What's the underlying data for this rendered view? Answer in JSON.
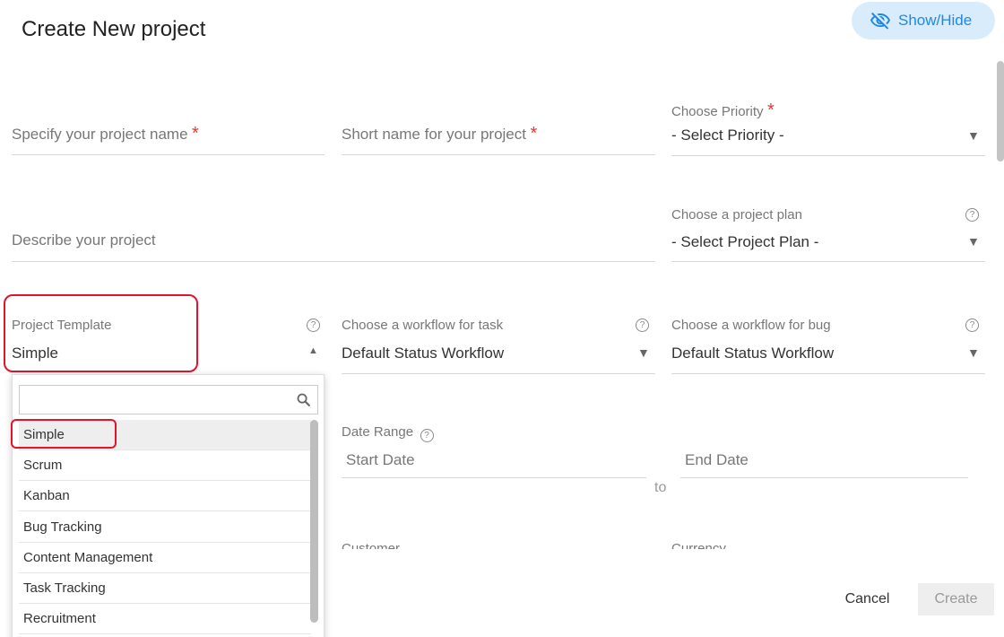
{
  "header": {
    "title": "Create New project",
    "show_hide_label": "Show/Hide"
  },
  "form": {
    "project_name_placeholder": "Specify your project name",
    "short_name_placeholder": "Short name for your project",
    "priority_label": "Choose Priority",
    "priority_value": "- Select Priority -",
    "description_placeholder": "Describe your project",
    "plan_label": "Choose a project plan",
    "plan_value": "- Select Project Plan -",
    "template_label": "Project Template",
    "template_value": "Simple",
    "task_workflow_label": "Choose a workflow for task",
    "task_workflow_value": "Default Status Workflow",
    "bug_workflow_label": "Choose a workflow for bug",
    "bug_workflow_value": "Default Status Workflow",
    "date_range_label": "Date Range",
    "start_date_placeholder": "Start Date",
    "end_date_placeholder": "End Date",
    "to_label": "to",
    "customer_label": "Customer",
    "currency_label": "Currency",
    "required_mark": "*",
    "help_mark": "?"
  },
  "template_dropdown": {
    "options": [
      "Simple",
      "Scrum",
      "Kanban",
      "Bug Tracking",
      "Content Management",
      "Task Tracking",
      "Recruitment"
    ],
    "selected": "Simple"
  },
  "footer": {
    "cancel_label": "Cancel",
    "create_label": "Create"
  },
  "colors": {
    "accent": "#1e88e5",
    "required": "#e53935",
    "highlight_box": "#e0152b"
  }
}
